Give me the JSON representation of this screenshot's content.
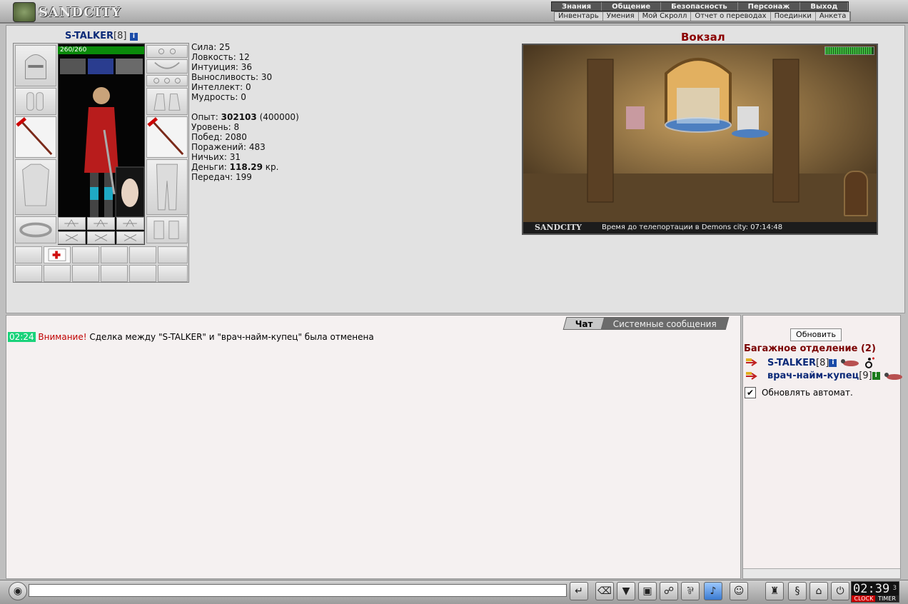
{
  "app": {
    "name": "SANDCITY"
  },
  "menu": {
    "primary": [
      "Знания",
      "Общение",
      "Безопасность",
      "Персонаж",
      "Выход"
    ],
    "secondary": [
      "Инвентарь",
      "Умения",
      "Мой Скролл",
      "Отчет о переводах",
      "Поединки",
      "Анкета"
    ]
  },
  "character": {
    "name": "S-TALKER",
    "level": "[8]",
    "info": "i",
    "hp": "260/260",
    "stats": {
      "strength": "Сила: 25",
      "agility": "Ловкость: 12",
      "intuition": "Интуиция: 36",
      "endurance": "Выносливость: 30",
      "intellect": "Интеллект: 0",
      "wisdom": "Мудрость: 0"
    },
    "experience": {
      "label": "Опыт:",
      "value": "302103",
      "next": "(400000)"
    },
    "level_line": "Уровень: 8",
    "wins": "Побед: 2080",
    "losses": "Поражений: 483",
    "draws": "Ничьих: 31",
    "money": {
      "label": "Деньги:",
      "value": "118.29",
      "unit": "кр."
    },
    "transfers": "Передач: 199"
  },
  "location": {
    "title": "Вокзал",
    "brand": "SANDCITY",
    "teleport_timer": "Время до телепортации в Demons city: 07:14:48",
    "meter_fraction": 0.95
  },
  "chat": {
    "tabs": {
      "chat": "Чат",
      "system": "Системные сообщения"
    },
    "message": {
      "time": "02:24",
      "prefix": "Внимание!",
      "text": " Сделка между \"S-TALKER\" и \"врач-найм-купец\" была отменена"
    }
  },
  "room": {
    "refresh_label": "Обновить",
    "title": "Багажное отделение (2)",
    "users": [
      {
        "name": "S-TALKER",
        "level": "[8]"
      },
      {
        "name": "врач-найм-купец",
        "level": "[9]"
      }
    ],
    "auto_refresh": {
      "label": "Обновлять автомат.",
      "checked": true
    }
  },
  "clock": {
    "time": "02:39",
    "sec": "3",
    "clock_label": "CLOCK",
    "timer_label": "TIMER"
  },
  "colors": {
    "hp": "#0a8a0a",
    "name": "#0b2a78",
    "warning": "#c00000",
    "time_bg": "#19d27a",
    "room_title": "#7a0000"
  }
}
